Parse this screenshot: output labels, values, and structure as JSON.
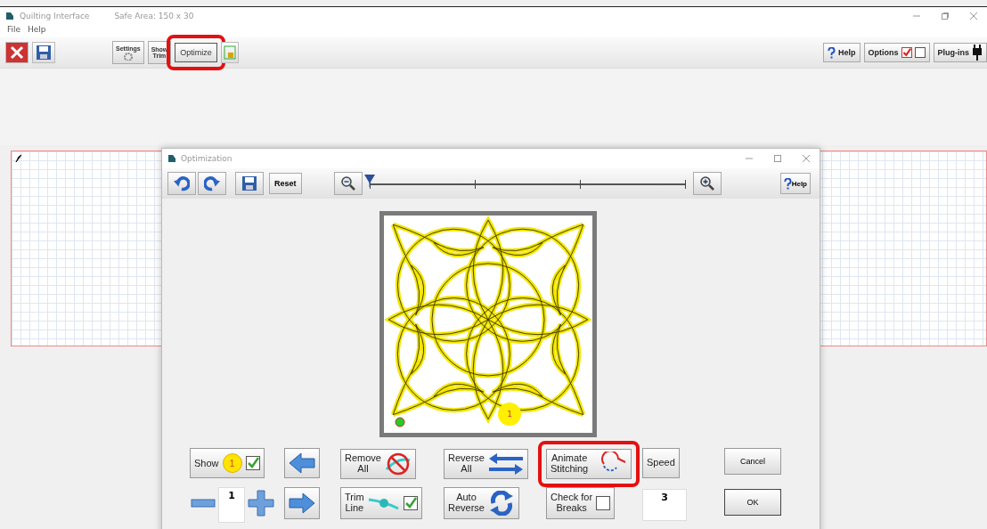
{
  "window": {
    "title": "Quilting Interface",
    "safe_area": "Safe Area:  150 x 30"
  },
  "menu": [
    "File",
    "Help"
  ],
  "toolbar_left": [
    {
      "kind": "close",
      "highlighted": false
    },
    {
      "kind": "save",
      "highlighted": false
    },
    {
      "kind": "settings",
      "lines": [
        "Settings"
      ],
      "highlighted": false
    },
    {
      "kind": "show_trim",
      "lines": [
        "Show",
        "Trim"
      ],
      "highlighted": false
    },
    {
      "kind": "optimize",
      "lines": [
        "Optimize"
      ],
      "highlighted": true
    },
    {
      "kind": "lock",
      "highlighted": false
    }
  ],
  "toolbar_right": [
    {
      "kind": "help",
      "label": "Help"
    },
    {
      "kind": "options",
      "label": "Options",
      "checks": [
        true,
        false
      ]
    },
    {
      "kind": "plugins",
      "label": "Plug-ins"
    }
  ],
  "dialog": {
    "title": "Optimization",
    "toolbar": [
      {
        "kind": "undo"
      },
      {
        "kind": "redo"
      },
      {
        "kind": "save"
      },
      {
        "kind": "reset",
        "label": "Reset"
      },
      {
        "kind": "zoom_out"
      },
      {
        "kind": "slider",
        "level": 0
      },
      {
        "kind": "zoom_in"
      },
      {
        "kind": "help",
        "label": "Help"
      }
    ],
    "pattern": {
      "marker": "1"
    },
    "rows": [
      [
        {
          "kind": "show",
          "label": "Show",
          "badge": "1",
          "checked": true,
          "highlighted": false
        },
        {
          "kind": "arrow_left",
          "highlighted": false
        },
        {
          "kind": "remove_all",
          "lines": [
            "Remove",
            "All"
          ],
          "highlighted": false
        },
        {
          "kind": "reverse_all",
          "lines": [
            "Reverse",
            "All"
          ],
          "highlighted": false
        },
        {
          "kind": "animate",
          "lines": [
            "Animate",
            "Stitching"
          ],
          "highlighted": true
        },
        {
          "kind": "plain",
          "lines": [
            "Speed"
          ],
          "highlighted": false
        },
        {
          "kind": "dialog_button",
          "label": "Cancel",
          "highlighted": false
        }
      ],
      [
        {
          "kind": "stepper",
          "value": "1",
          "highlighted": false
        },
        {
          "kind": "arrow_right",
          "highlighted": false
        },
        {
          "kind": "trim_line",
          "lines": [
            "Trim",
            "Line"
          ],
          "checked": true,
          "highlighted": false
        },
        {
          "kind": "auto_reverse",
          "lines": [
            "Auto",
            "Reverse"
          ],
          "highlighted": false
        },
        {
          "kind": "check_breaks",
          "lines": [
            "Check for",
            "Breaks"
          ],
          "checked": false,
          "highlighted": false
        },
        {
          "kind": "value_field",
          "value": "3",
          "highlighted": false
        },
        {
          "kind": "dialog_button",
          "label": "OK",
          "highlighted": false
        }
      ]
    ]
  }
}
